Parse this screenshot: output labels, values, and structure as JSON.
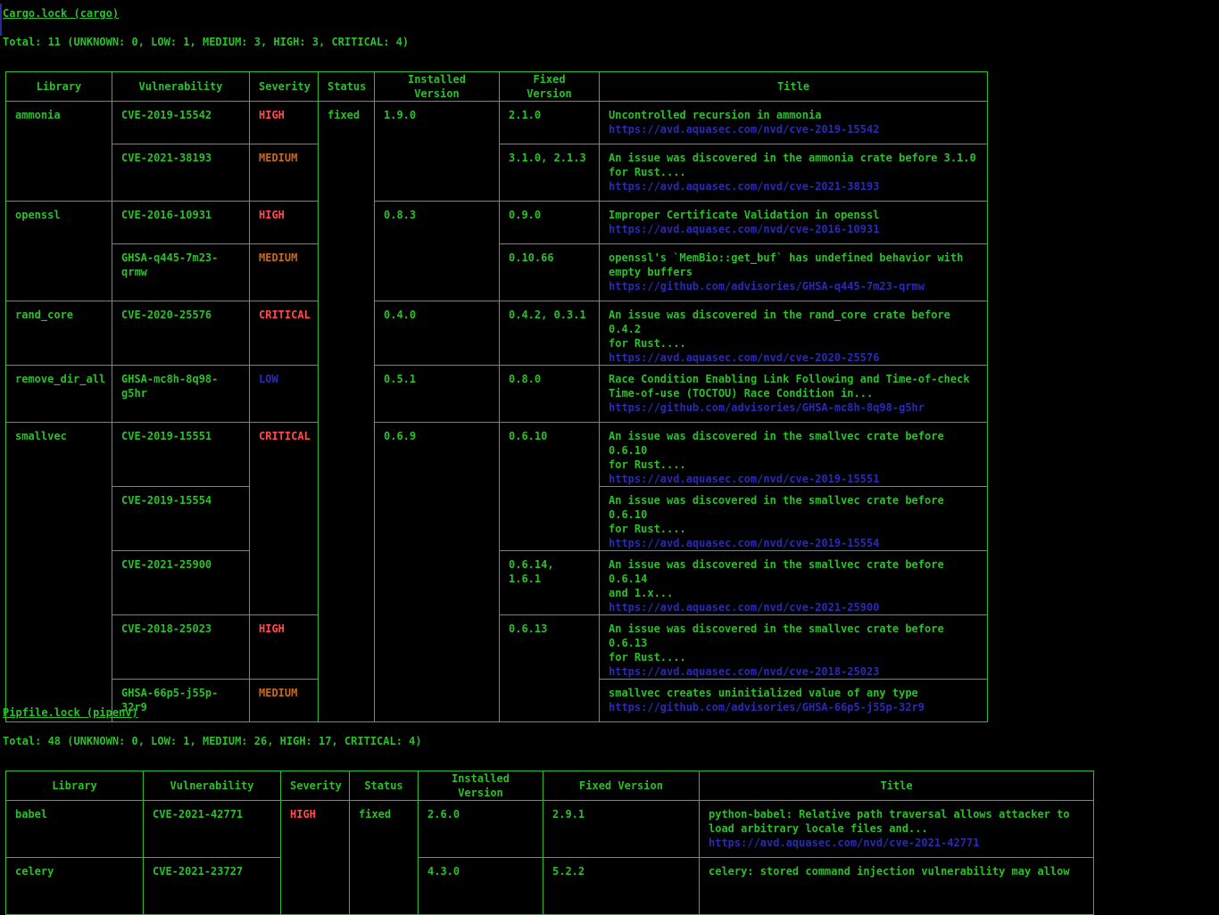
{
  "sections": [
    {
      "heading": "Cargo.lock (cargo)",
      "total": "Total: 11 (UNKNOWN: 0, LOW: 1, MEDIUM: 3, HIGH: 3, CRITICAL: 4)",
      "columns": [
        "Library",
        "Vulnerability",
        "Severity",
        "Status",
        "Installed Version",
        "Fixed Version",
        "Title"
      ],
      "rows": [
        {
          "library": "ammonia",
          "vuln": "CVE-2019-15542",
          "severity": "HIGH",
          "status": "fixed",
          "installed": "1.9.0",
          "fixed": "2.1.0",
          "title": "Uncontrolled recursion in ammonia",
          "url": "https://avd.aquasec.com/nvd/cve-2019-15542"
        },
        {
          "library": "",
          "vuln": "CVE-2021-38193",
          "severity": "MEDIUM",
          "status": "",
          "installed": "",
          "fixed": "3.1.0, 2.1.3",
          "title": "An issue was discovered in the ammonia crate before 3.1.0\nfor Rust....",
          "url": "https://avd.aquasec.com/nvd/cve-2021-38193"
        },
        {
          "library": "openssl",
          "vuln": "CVE-2016-10931",
          "severity": "HIGH",
          "status": "",
          "installed": "0.8.3",
          "fixed": "0.9.0",
          "title": "Improper Certificate Validation in openssl",
          "url": "https://avd.aquasec.com/nvd/cve-2016-10931"
        },
        {
          "library": "",
          "vuln": "GHSA-q445-7m23-qrmw",
          "severity": "MEDIUM",
          "status": "",
          "installed": "",
          "fixed": "0.10.66",
          "title": "openssl's `MemBio::get_buf` has undefined behavior with\nempty buffers",
          "url": "https://github.com/advisories/GHSA-q445-7m23-qrmw"
        },
        {
          "library": "rand_core",
          "vuln": "CVE-2020-25576",
          "severity": "CRITICAL",
          "status": "",
          "installed": "0.4.0",
          "fixed": "0.4.2, 0.3.1",
          "title": "An issue was discovered in the rand_core crate before 0.4.2\nfor Rust....",
          "url": "https://avd.aquasec.com/nvd/cve-2020-25576"
        },
        {
          "library": "remove_dir_all",
          "vuln": "GHSA-mc8h-8q98-g5hr",
          "severity": "LOW",
          "status": "",
          "installed": "0.5.1",
          "fixed": "0.8.0",
          "title": "Race Condition Enabling Link Following and Time-of-check\nTime-of-use (TOCTOU) Race Condition in...",
          "url": "https://github.com/advisories/GHSA-mc8h-8q98-g5hr"
        },
        {
          "library": "smallvec",
          "vuln": "CVE-2019-15551",
          "severity": "CRITICAL",
          "status": "",
          "installed": "0.6.9",
          "fixed": "0.6.10",
          "title": "An issue was discovered in the smallvec crate before 0.6.10\nfor Rust....",
          "url": "https://avd.aquasec.com/nvd/cve-2019-15551"
        },
        {
          "library": "",
          "vuln": "CVE-2019-15554",
          "severity": "",
          "status": "",
          "installed": "",
          "fixed": "",
          "title": "An issue was discovered in the smallvec crate before 0.6.10\nfor Rust....",
          "url": "https://avd.aquasec.com/nvd/cve-2019-15554"
        },
        {
          "library": "",
          "vuln": "CVE-2021-25900",
          "severity": "",
          "status": "",
          "installed": "",
          "fixed": "0.6.14, 1.6.1",
          "title": "An issue was discovered in the smallvec crate before 0.6.14\nand 1.x...",
          "url": "https://avd.aquasec.com/nvd/cve-2021-25900"
        },
        {
          "library": "",
          "vuln": "CVE-2018-25023",
          "severity": "HIGH",
          "status": "",
          "installed": "",
          "fixed": "0.6.13",
          "title": "An issue was discovered in the smallvec crate before 0.6.13\nfor Rust....",
          "url": "https://avd.aquasec.com/nvd/cve-2018-25023"
        },
        {
          "library": "",
          "vuln": "GHSA-66p5-j55p-32r9",
          "severity": "MEDIUM",
          "status": "",
          "installed": "",
          "fixed": "",
          "title": "smallvec creates uninitialized value of any type",
          "url": "https://github.com/advisories/GHSA-66p5-j55p-32r9"
        }
      ]
    },
    {
      "heading": "Pipfile.lock (pipenv)",
      "total": "Total: 48 (UNKNOWN: 0, LOW: 1, MEDIUM: 26, HIGH: 17, CRITICAL: 4)",
      "columns": [
        "Library",
        "Vulnerability",
        "Severity",
        "Status",
        "Installed Version",
        "Fixed Version",
        "Title"
      ],
      "rows": [
        {
          "library": "babel",
          "vuln": "CVE-2021-42771",
          "severity": "HIGH",
          "status": "fixed",
          "installed": "2.6.0",
          "fixed": "2.9.1",
          "title": "python-babel: Relative path traversal allows attacker to\nload arbitrary locale files and...",
          "url": "https://avd.aquasec.com/nvd/cve-2021-42771"
        },
        {
          "library": "celery",
          "vuln": "CVE-2021-23727",
          "severity": "",
          "status": "",
          "installed": "4.3.0",
          "fixed": "5.2.2",
          "title": "celery: stored command injection vulnerability may allow",
          "url": ""
        }
      ]
    }
  ]
}
